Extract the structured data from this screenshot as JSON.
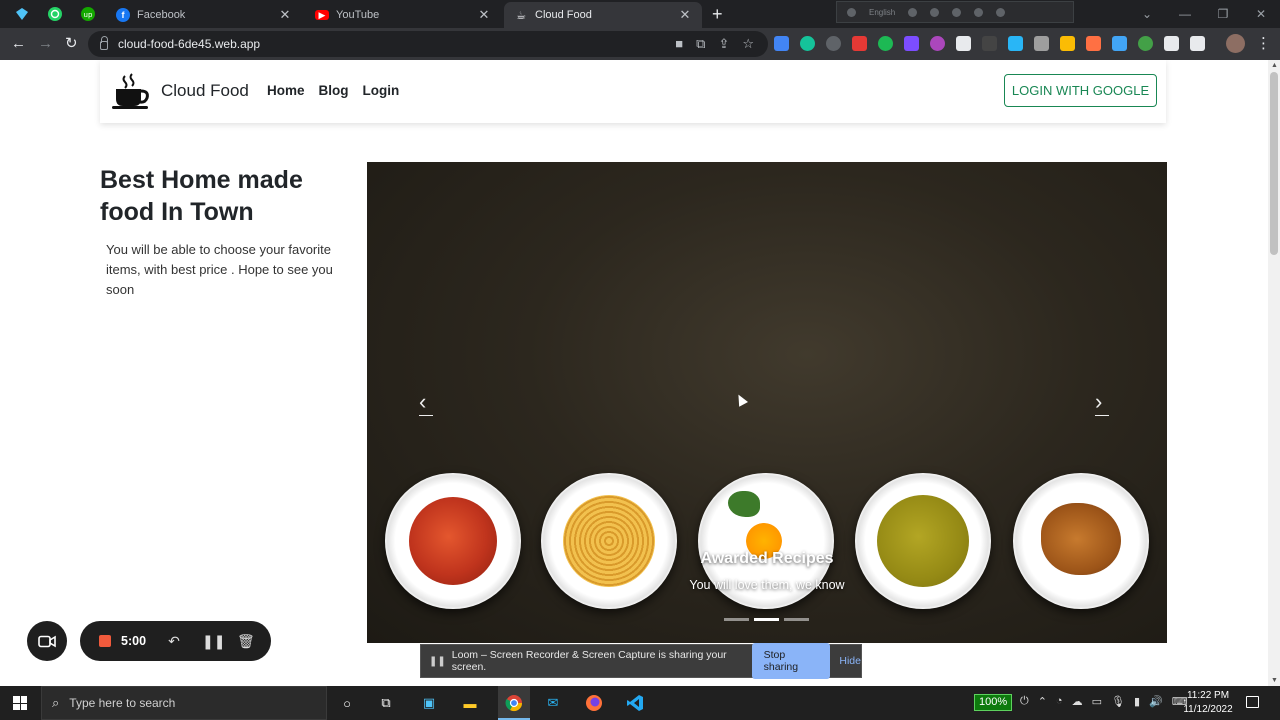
{
  "browser": {
    "tabs": [
      {
        "title": "Facebook",
        "active": false
      },
      {
        "title": "YouTube",
        "active": false
      },
      {
        "title": "Cloud Food",
        "active": true
      }
    ],
    "url": "cloud-food-6de45.web.app",
    "extension_language_label": "English"
  },
  "navbar": {
    "brand": "Cloud Food",
    "links": [
      "Home",
      "Blog",
      "Login"
    ],
    "google_button": "LOGIN WITH GOOGLE"
  },
  "hero": {
    "title": "Best Home made food In Town",
    "text": "You will be able to choose your favorite items, with best price . Hope to see you soon"
  },
  "carousel": {
    "caption_title": "Awarded Recipes",
    "caption_text": "You will love them, we know",
    "slide_count": 3,
    "active_slide": 1,
    "prev_icon": "chevron-left-icon",
    "next_icon": "chevron-right-icon"
  },
  "loom": {
    "share_message": "Loom – Screen Recorder & Screen Capture is sharing your screen.",
    "stop_button": "Stop sharing",
    "hide_button": "Hide",
    "timer": "5:00"
  },
  "taskbar": {
    "search_placeholder": "Type here to search",
    "battery": "100%",
    "time": "11:22 PM",
    "date": "11/12/2022"
  },
  "colors": {
    "brand_green": "#198754",
    "chrome_dark": "#202124",
    "record_red": "#f05a3c",
    "loom_blue": "#8ab4f8"
  }
}
